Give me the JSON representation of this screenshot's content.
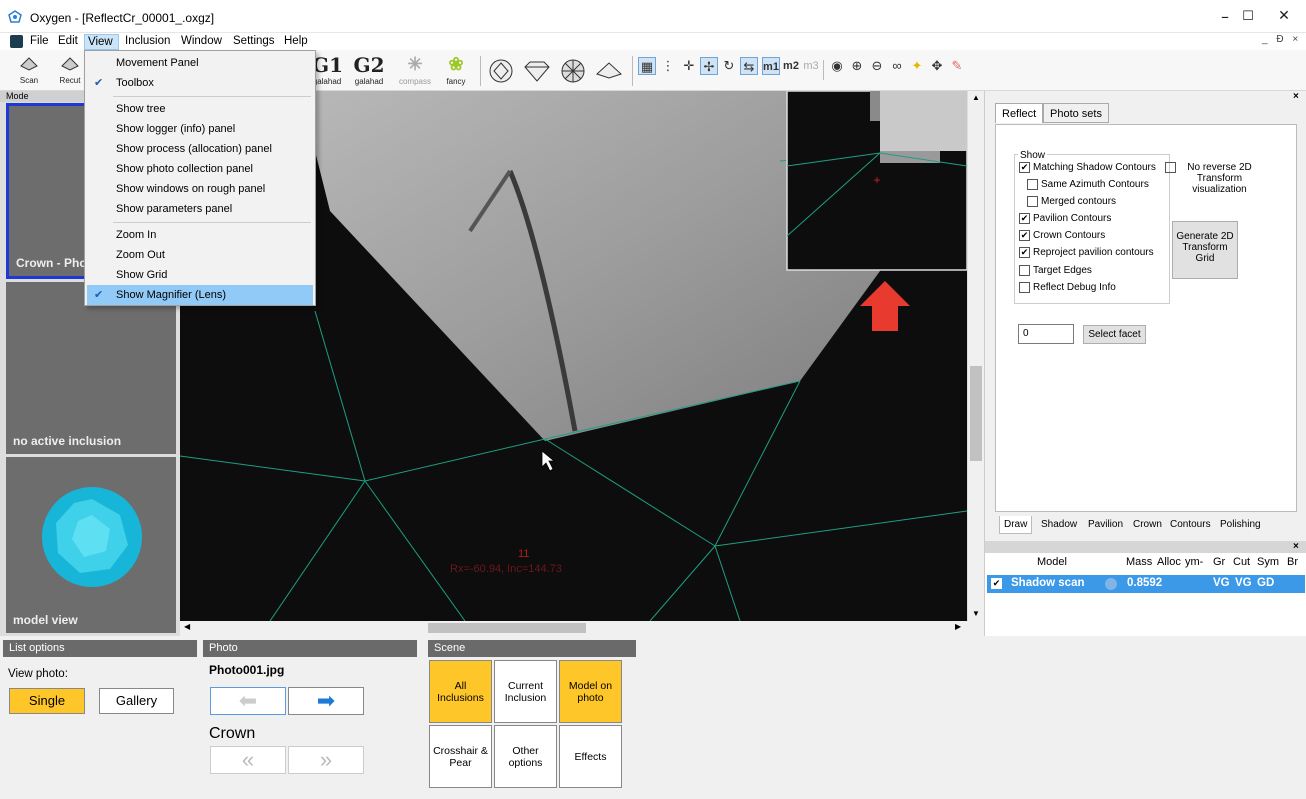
{
  "window": {
    "title": "Oxygen - [ReflectCr_00001_.oxgz]",
    "min_glyph": "–",
    "max_glyph": "☐",
    "close_glyph": "✕",
    "mdi_controls": "_ Ɖ ×"
  },
  "menubar": {
    "items": [
      "File",
      "Edit",
      "View",
      "Inclusion",
      "Window",
      "Settings",
      "Help"
    ]
  },
  "toolbar": {
    "scan_label": "Scan",
    "recut_label": "Recut",
    "g1_glyph": "G1",
    "g1_label": "galahad",
    "g2_glyph": "G2",
    "g2_label": "galahad",
    "compass_label": "compass",
    "fancy_label": "fancy",
    "m1": "m1",
    "m2": "m2",
    "m3": "m3"
  },
  "view_menu": {
    "items": [
      {
        "label": "Movement Panel",
        "checked": false
      },
      {
        "label": "Toolbox",
        "checked": true
      },
      {
        "label": "Show tree",
        "checked": false
      },
      {
        "label": "Show logger (info) panel",
        "checked": false
      },
      {
        "label": "Show process (allocation) panel",
        "checked": false
      },
      {
        "label": "Show photo collection panel",
        "checked": false
      },
      {
        "label": "Show windows on rough panel",
        "checked": false
      },
      {
        "label": "Show parameters panel",
        "checked": false
      },
      {
        "label": "Zoom In",
        "checked": false
      },
      {
        "label": "Zoom Out",
        "checked": false
      },
      {
        "label": "Show Grid",
        "checked": false
      },
      {
        "label": "Show Magnifier (Lens)",
        "checked": true
      }
    ],
    "check_glyph": "✔"
  },
  "mode_panel": {
    "header": "Mode",
    "tiles": [
      "Crown - Pho",
      "no active inclusion",
      "model view"
    ]
  },
  "viewport": {
    "facet_number": "11",
    "facet_info": "Rx=-60.94, Inc=144.73"
  },
  "right_panel": {
    "tabs": [
      "Reflect",
      "Photo sets"
    ],
    "show_group_title": "Show",
    "checkboxes": [
      {
        "label": "Matching Shadow Contours",
        "checked": true
      },
      {
        "label": "Same Azimuth Contours",
        "checked": false
      },
      {
        "label": "Merged contours",
        "checked": false
      },
      {
        "label": "Pavilion Contours",
        "checked": true
      },
      {
        "label": "Crown Contours",
        "checked": true
      },
      {
        "label": "Reproject pavilion contours",
        "checked": true
      },
      {
        "label": "Target Edges",
        "checked": false
      },
      {
        "label": "Reflect Debug Info",
        "checked": false
      }
    ],
    "no_reverse_label": "No reverse 2D Transform visualization",
    "generate_btn": "Generate 2D Transform Grid",
    "facet_input_value": "0",
    "select_facet_btn": "Select facet",
    "bottom_tabs": [
      "Draw",
      "Shadow",
      "Pavilion",
      "Crown",
      "Contours",
      "Polishing"
    ],
    "check_glyph": "✔"
  },
  "model_table": {
    "columns": [
      "Model",
      "Mass",
      "Alloc",
      "ym-",
      "Gr",
      "Cut",
      "Sym",
      "Br"
    ],
    "row": {
      "name": "Shadow scan",
      "mass": "0.8592",
      "gr": "VG",
      "cut": "VG",
      "sym": "GD"
    },
    "check_glyph": "✔"
  },
  "bottom": {
    "list_options": {
      "header": "List options",
      "view_photo_label": "View photo:",
      "single": "Single",
      "gallery": "Gallery"
    },
    "photo": {
      "header": "Photo",
      "filename": "Photo001.jpg",
      "side": "Crown"
    },
    "scene": {
      "header": "Scene",
      "buttons": [
        "All Inclusions",
        "Current Inclusion",
        "Model on photo",
        "Crosshair & Pear",
        "Other options",
        "Effects"
      ]
    }
  }
}
